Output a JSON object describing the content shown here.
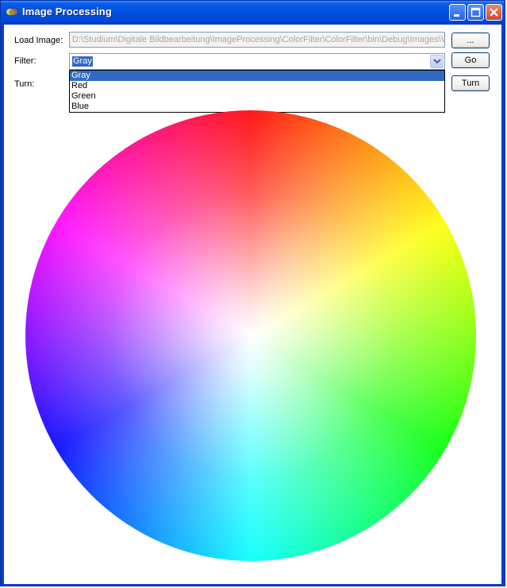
{
  "window": {
    "title": "Image Processing",
    "icon": "app-icon",
    "controls": [
      "minimize-icon",
      "maximize-icon",
      "close-icon"
    ]
  },
  "form": {
    "load_image_label": "Load Image:",
    "load_image_path": "D:\\Studium\\Digitale Bildbearbeitung\\ImageProcessing\\ColorFilter\\ColorFilter\\bin\\Debug\\Images\\Va",
    "filter_label": "Filter:",
    "filter_selected": "Gray",
    "filter_options": [
      "Gray",
      "Red",
      "Green",
      "Blue"
    ],
    "turn_label": "Turn:",
    "browse_button": "...",
    "go_button": "Go",
    "turn_button": "Turn"
  },
  "image": {
    "content": "color-wheel",
    "colors": [
      "#ff0000",
      "#ffff00",
      "#00ff00",
      "#00ffff",
      "#0000ff",
      "#ff00ff"
    ]
  },
  "colors": {
    "titlebar": "#0054e3",
    "selection": "#316ac5"
  }
}
